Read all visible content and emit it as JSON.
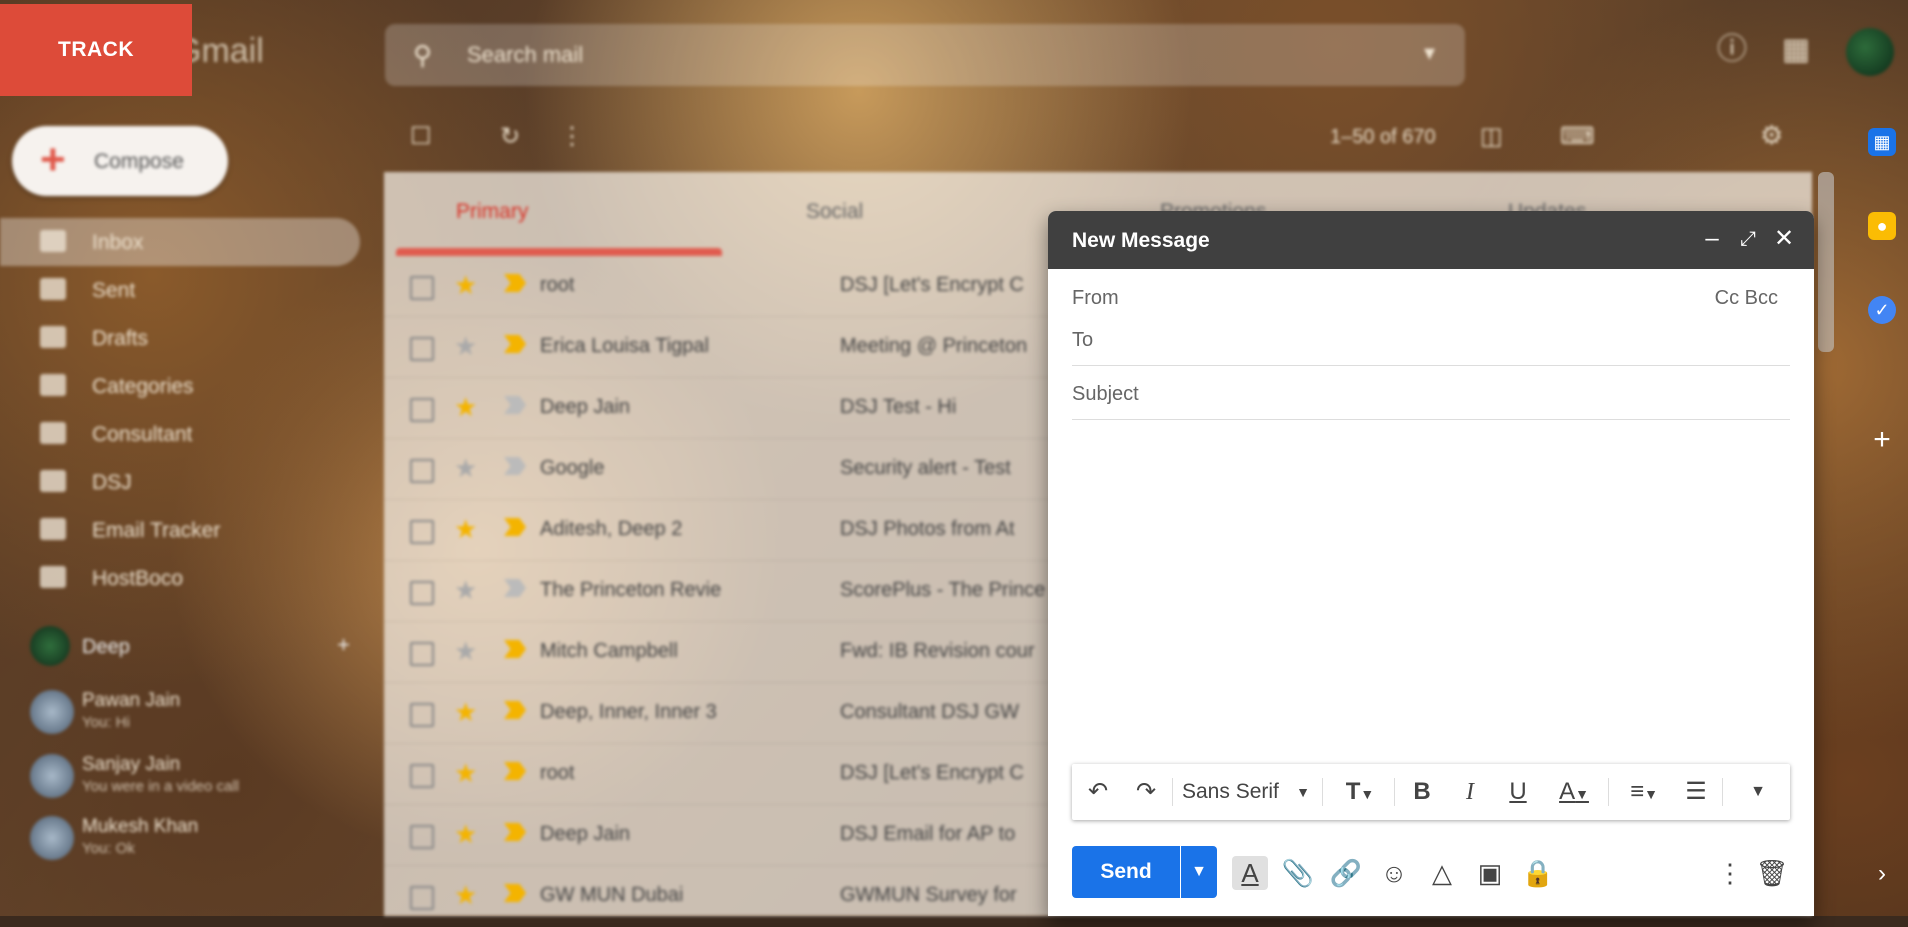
{
  "track": {
    "label": "TRACK"
  },
  "topbar": {
    "logo": "Gmail",
    "search_placeholder": "Search mail"
  },
  "sidebar": {
    "compose_label": "Compose",
    "items": [
      {
        "label": "Inbox"
      },
      {
        "label": "Sent"
      },
      {
        "label": "Drafts"
      },
      {
        "label": "Categories"
      },
      {
        "label": "Consultant"
      },
      {
        "label": "DSJ"
      },
      {
        "label": "Email Tracker"
      },
      {
        "label": "HostBoco"
      }
    ],
    "hangouts_user": "Deep",
    "contacts": [
      {
        "name": "Pawan Jain",
        "status": "You: Hi"
      },
      {
        "name": "Sanjay Jain",
        "status": "You were in a video call"
      },
      {
        "name": "Mukesh Khan",
        "status": "You: Ok"
      }
    ]
  },
  "toolbar": {
    "pagination": "1–50 of 670"
  },
  "tabs": [
    {
      "label": "Primary"
    },
    {
      "label": "Social"
    },
    {
      "label": "Promotions"
    },
    {
      "label": "Updates"
    }
  ],
  "emails": [
    {
      "sender": "root",
      "subject": "DSJ  [Let's Encrypt C",
      "starred": true,
      "important": true
    },
    {
      "sender": "Erica Louisa Tigpal",
      "subject": "Meeting @ Princeton",
      "starred": false,
      "important": true
    },
    {
      "sender": "Deep Jain",
      "subject": "DSJ  Test - Hi",
      "starred": true,
      "important": false
    },
    {
      "sender": "Google",
      "subject": "Security alert - Test",
      "starred": false,
      "important": false
    },
    {
      "sender": "Aditesh, Deep 2",
      "subject": "DSJ  Photos from At",
      "starred": true,
      "important": true
    },
    {
      "sender": "The Princeton Revie",
      "subject": "ScorePlus - The Prince",
      "starred": false,
      "important": false
    },
    {
      "sender": "Mitch Campbell",
      "subject": "Fwd: IB Revision cour",
      "starred": false,
      "important": true
    },
    {
      "sender": "Deep, Inner, Inner 3",
      "subject": "Consultant  DSJ  GW",
      "starred": true,
      "important": true
    },
    {
      "sender": "root",
      "subject": "DSJ  [Let's Encrypt C",
      "starred": true,
      "important": true
    },
    {
      "sender": "Deep Jain",
      "subject": "DSJ  Email for AP to",
      "starred": true,
      "important": true
    },
    {
      "sender": "GW MUN Dubai",
      "subject": "GWMUN Survey for",
      "starred": true,
      "important": true
    }
  ],
  "compose": {
    "title": "New Message",
    "from_label": "From",
    "cc_bcc": "Cc Bcc",
    "to_label": "To",
    "subject_placeholder": "Subject",
    "font_name": "Sans Serif",
    "send_label": "Send"
  },
  "colors": {
    "track": "#dd4b39",
    "send": "#1a73e8",
    "header": "#404040"
  }
}
